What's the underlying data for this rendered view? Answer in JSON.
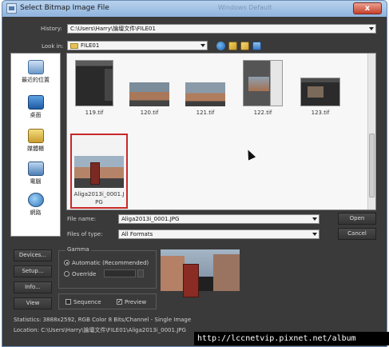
{
  "window": {
    "title": "Select Bitmap Image File",
    "ghost_title": "Windows Default",
    "close_glyph": "x"
  },
  "history": {
    "label": "History:",
    "value": "C:\\Users\\Harry\\論壇文件\\FILE01"
  },
  "look_in": {
    "label": "Look in:",
    "value": "FILE01"
  },
  "toolbar_icons": [
    "back-icon",
    "up-folder-icon",
    "new-folder-icon",
    "view-menu-icon"
  ],
  "places": [
    {
      "label": "最近的位置",
      "icon": "recent-places-icon"
    },
    {
      "label": "桌面",
      "icon": "desktop-icon"
    },
    {
      "label": "媒體櫃",
      "icon": "libraries-icon"
    },
    {
      "label": "電腦",
      "icon": "computer-icon"
    },
    {
      "label": "網路",
      "icon": "network-icon"
    }
  ],
  "files": [
    {
      "name": "119.tif"
    },
    {
      "name": "120.tif"
    },
    {
      "name": "121.tif"
    },
    {
      "name": "122.tif"
    },
    {
      "name": "123.tif"
    },
    {
      "name_line1": "Aliga2013i_0001.J",
      "name_line2": "PG",
      "selected": true
    }
  ],
  "file_name": {
    "label": "File name:",
    "value": "Aliga2013i_0001.JPG"
  },
  "files_of_type": {
    "label": "Files of type:",
    "value": "All Formats"
  },
  "buttons": {
    "open": "Open",
    "cancel": "Cancel",
    "devices": "Devices...",
    "setup": "Setup...",
    "info": "Info...",
    "view": "View"
  },
  "gamma": {
    "title": "Gamma",
    "automatic": "Automatic (Recommended)",
    "override": "Override",
    "selected": "automatic"
  },
  "options": {
    "sequence": "Sequence",
    "sequence_checked": false,
    "preview": "Preview",
    "preview_checked": true,
    "check_glyph": "✓"
  },
  "status": {
    "statistics": "Statistics: 3888x2592, RGB Color 8 Bits/Channel - Single Image",
    "location": "Location: C:\\Users\\Harry\\論壇文件\\FILE01\\Aliga2013i_0001.JPG"
  },
  "watermark": "http://lccnetvip.pixnet.net/album",
  "colors": {
    "dialog_bg": "#3a3a3a",
    "titlebar": "#a6c4e6",
    "selection_border": "#c8282a",
    "close_button": "#c6402b"
  }
}
